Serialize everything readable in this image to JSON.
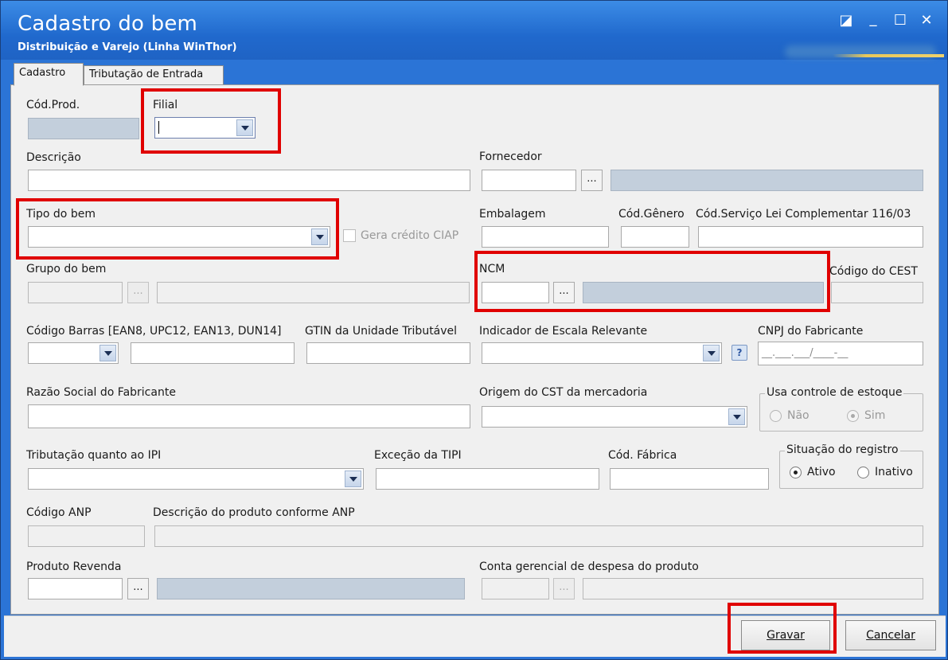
{
  "window": {
    "title": "Cadastro do bem",
    "subtitle": "Distribuição e Varejo (Linha WinThor)",
    "controls": {
      "restore": "◪",
      "minimize": "_",
      "maximize": "☐",
      "close": "✕"
    }
  },
  "tabs": [
    {
      "label": "Cadastro",
      "active": true
    },
    {
      "label": "Tributação de Entrada",
      "active": false
    }
  ],
  "form": {
    "cod_prod": {
      "label": "Cód.Prod.",
      "value": ""
    },
    "filial": {
      "label": "Filial",
      "value": ""
    },
    "descricao": {
      "label": "Descrição",
      "value": ""
    },
    "fornecedor": {
      "label": "Fornecedor",
      "value": "",
      "lookup": "..."
    },
    "tipo_bem": {
      "label": "Tipo do bem",
      "value": ""
    },
    "gera_credito": {
      "label": "Gera crédito CIAP",
      "checked": false
    },
    "embalagem": {
      "label": "Embalagem",
      "value": ""
    },
    "cod_genero": {
      "label": "Cód.Gênero",
      "value": ""
    },
    "cod_servico": {
      "label": "Cód.Serviço Lei Complementar 116/03",
      "value": ""
    },
    "grupo_bem": {
      "label": "Grupo do bem",
      "lookup": "..."
    },
    "ncm": {
      "label": "NCM",
      "value": "",
      "lookup": "..."
    },
    "codigo_cest": {
      "label": "Código do CEST",
      "value": ""
    },
    "codigo_barras": {
      "label": "Código Barras [EAN8, UPC12, EAN13, DUN14]",
      "value": ""
    },
    "gtin": {
      "label": "GTIN da Unidade Tributável",
      "value": ""
    },
    "indicador_escala": {
      "label": "Indicador de Escala Relevante",
      "value": ""
    },
    "cnpj_fabricante": {
      "label": "CNPJ do Fabricante",
      "mask": "__.___.___/____-__"
    },
    "razao_social": {
      "label": "Razão Social do Fabricante",
      "value": ""
    },
    "origem_cst": {
      "label": "Origem do CST da mercadoria",
      "value": ""
    },
    "usa_controle": {
      "label": "Usa controle de estoque",
      "options": [
        "Não",
        "Sim"
      ],
      "selected": "Sim"
    },
    "tributacao_ipi": {
      "label": "Tributação quanto ao IPI",
      "value": ""
    },
    "excecao_tipi": {
      "label": "Exceção da TIPI",
      "value": ""
    },
    "cod_fabrica": {
      "label": "Cód. Fábrica",
      "value": ""
    },
    "situacao": {
      "label": "Situação do registro",
      "options": [
        "Ativo",
        "Inativo"
      ],
      "selected": "Ativo"
    },
    "codigo_anp": {
      "label": "Código ANP",
      "value": ""
    },
    "descricao_anp": {
      "label": "Descrição do produto conforme ANP",
      "value": ""
    },
    "produto_revenda": {
      "label": "Produto Revenda",
      "value": "",
      "lookup": "..."
    },
    "conta_gerencial": {
      "label": "Conta gerencial de despesa do produto",
      "lookup": "..."
    }
  },
  "footer": {
    "gravar": "Gravar",
    "cancelar": "Cancelar"
  },
  "colors": {
    "title_bar": "#2069cd",
    "panel": "#f0f0f0",
    "highlight": "#e00000",
    "readonly_field": "#c3cfdc"
  }
}
